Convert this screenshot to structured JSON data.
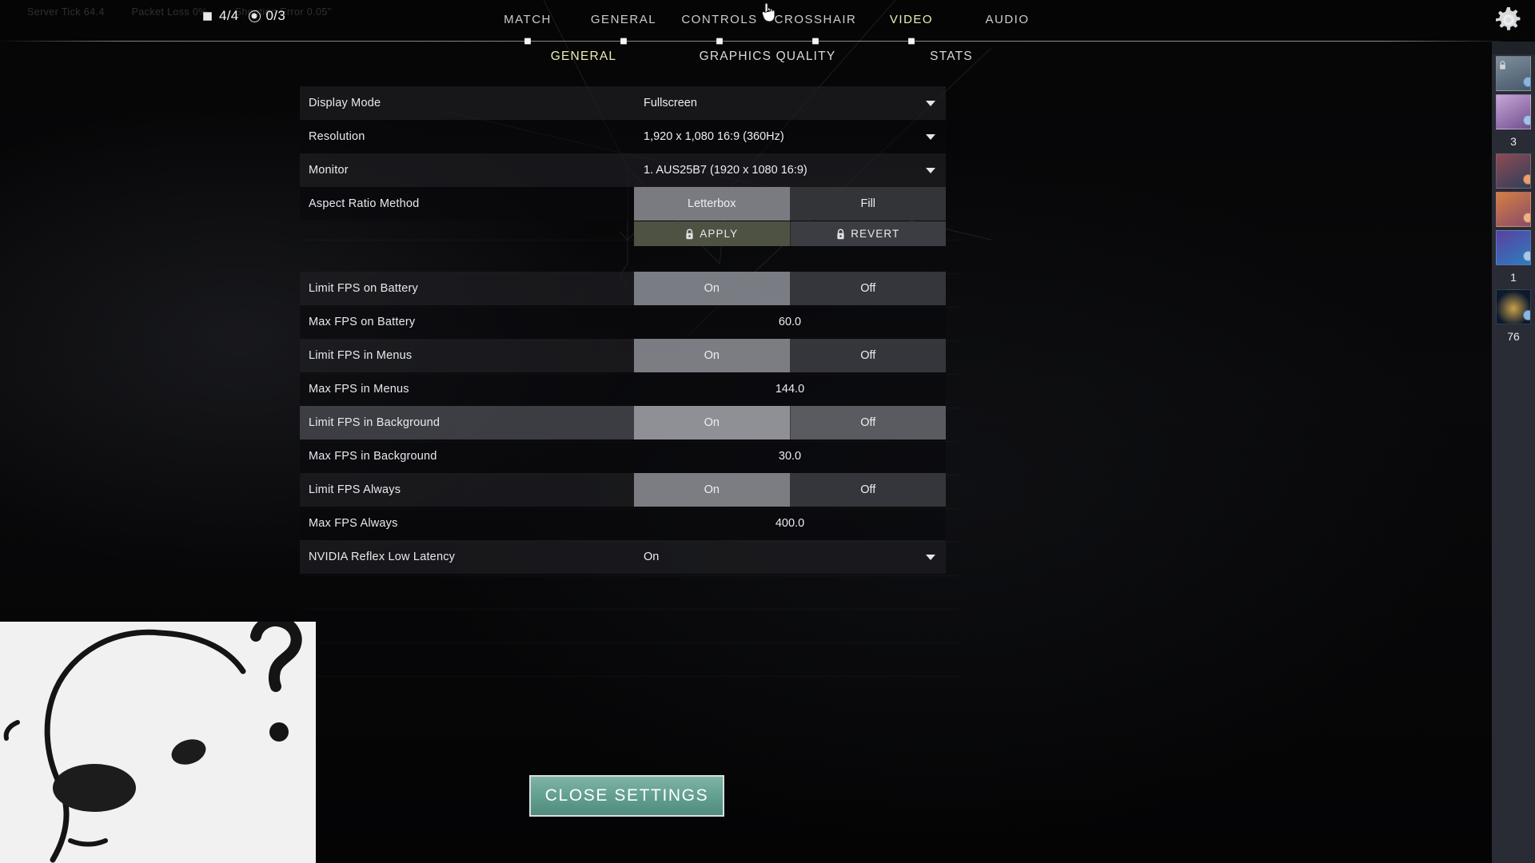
{
  "header": {
    "counters": [
      {
        "icon": "diamond-icon",
        "value": "4/4"
      },
      {
        "icon": "dot-icon",
        "value": "0/3"
      }
    ],
    "background_stats": [
      "Server Tick  64.4",
      "Packet Loss  0%",
      "Shooting Error 0.05\""
    ],
    "gear_icon": "gear-icon",
    "cursor_icon": "hand-cursor-icon"
  },
  "nav": {
    "tabs": [
      {
        "label": "MATCH",
        "active": false
      },
      {
        "label": "GENERAL",
        "active": false
      },
      {
        "label": "CONTROLS",
        "active": false
      },
      {
        "label": "CROSSHAIR",
        "active": false
      },
      {
        "label": "VIDEO",
        "active": true
      },
      {
        "label": "AUDIO",
        "active": false
      }
    ],
    "active_color": "#eceeb0"
  },
  "subnav": {
    "tabs": [
      {
        "label": "GENERAL",
        "active": true
      },
      {
        "label": "GRAPHICS QUALITY",
        "active": false
      },
      {
        "label": "STATS",
        "active": false
      }
    ]
  },
  "settings": {
    "rows": [
      {
        "label": "Display Mode",
        "type": "dropdown",
        "value": "Fullscreen",
        "style": "alt",
        "align": "left"
      },
      {
        "label": "Resolution",
        "type": "dropdown",
        "value": "1,920 x 1,080 16:9 (360Hz)",
        "style": "normal",
        "align": "left"
      },
      {
        "label": "Monitor",
        "type": "dropdown",
        "value": "1. AUS25B7 (1920 x  1080 16:9)",
        "style": "alt",
        "align": "left"
      },
      {
        "label": "Aspect Ratio Method",
        "type": "segmented",
        "options": [
          "Letterbox",
          "Fill"
        ],
        "selected": "Letterbox",
        "style": "normal"
      }
    ],
    "apply_row": {
      "apply_label": "APPLY",
      "revert_label": "REVERT",
      "lock_icon": "lock-icon",
      "apply_color": "#4e5243",
      "revert_color": "#3b3d42"
    },
    "rows2": [
      {
        "label": "Limit FPS on Battery",
        "type": "segmented",
        "options": [
          "On",
          "Off"
        ],
        "selected": "On",
        "style": "alt"
      },
      {
        "label": "Max FPS on Battery",
        "type": "number",
        "value": "60.0",
        "style": "normal"
      },
      {
        "label": "Limit FPS in Menus",
        "type": "segmented",
        "options": [
          "On",
          "Off"
        ],
        "selected": "On",
        "style": "alt"
      },
      {
        "label": "Max FPS in Menus",
        "type": "number",
        "value": "144.0",
        "style": "normal"
      },
      {
        "label": "Limit FPS in Background",
        "type": "segmented",
        "options": [
          "On",
          "Off"
        ],
        "selected": "On",
        "style": "highlighted"
      },
      {
        "label": "Max FPS in Background",
        "type": "number",
        "value": "30.0",
        "style": "normal"
      },
      {
        "label": "Limit FPS Always",
        "type": "segmented",
        "options": [
          "On",
          "Off"
        ],
        "selected": "On",
        "style": "alt"
      },
      {
        "label": "Max FPS Always",
        "type": "number",
        "value": "400.0",
        "style": "normal"
      },
      {
        "label": "NVIDIA Reflex Low Latency",
        "type": "dropdown",
        "value": "On",
        "style": "alt",
        "align": "left"
      }
    ]
  },
  "footer": {
    "close_label": "CLOSE SETTINGS",
    "close_color": "#63a091"
  },
  "sidebar": {
    "items": [
      {
        "kind": "card",
        "name": "sidebar-card-1",
        "colors": [
          "#7d8e9b",
          "#47596b"
        ],
        "dot": "#8ab6e0",
        "lock": true
      },
      {
        "kind": "card",
        "name": "sidebar-card-2",
        "colors": [
          "#c9a6d8",
          "#6f4f8e"
        ],
        "dot": "#9fc4e8",
        "lock": false
      },
      {
        "kind": "count",
        "name": "sidebar-count-3",
        "value": "3"
      },
      {
        "kind": "card",
        "name": "sidebar-card-3",
        "colors": [
          "#8e4a52",
          "#2e3f5c"
        ],
        "dot": "#e8a070",
        "lock": false
      },
      {
        "kind": "card",
        "name": "sidebar-card-4",
        "colors": [
          "#d4803f",
          "#8a4a6b"
        ],
        "dot": "#f0b080",
        "lock": false
      },
      {
        "kind": "card",
        "name": "sidebar-card-5",
        "colors": [
          "#5c3f9e",
          "#2a7fc0"
        ],
        "dot": "#a8c8e8",
        "lock": false
      },
      {
        "kind": "count",
        "name": "sidebar-count-1",
        "value": "1"
      },
      {
        "kind": "card",
        "name": "sidebar-card-6",
        "colors": [
          "#0d1a2e",
          "#caa24a"
        ],
        "dot": "#8ab6e0",
        "lock": false
      },
      {
        "kind": "count",
        "name": "sidebar-count-76",
        "value": "76"
      }
    ]
  },
  "overlay": {
    "name": "whiteboard-doodle",
    "description": "hand-drawn sketch with question mark"
  }
}
